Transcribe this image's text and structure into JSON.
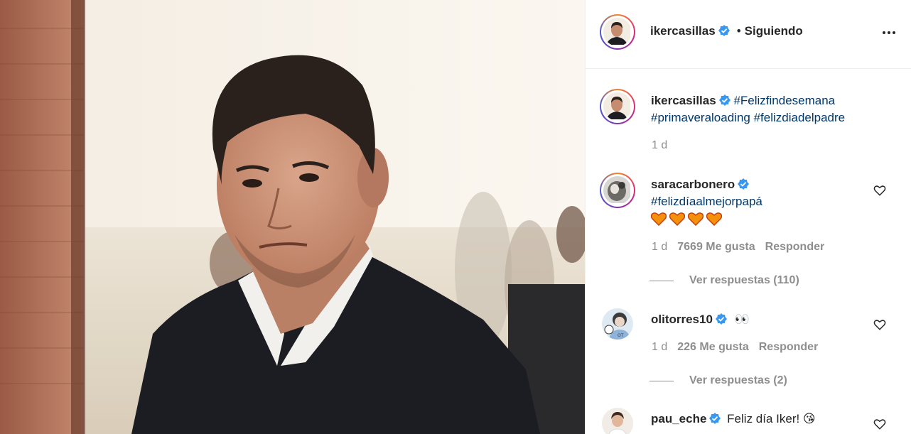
{
  "header": {
    "username": "ikercasillas",
    "separator": "•",
    "follow_status": "Siguiendo",
    "more_icon": "more-horizontal-icon"
  },
  "caption": {
    "username": "ikercasillas",
    "hashtags_line1": "#Felizfindesemana",
    "hashtags_line2": "#primaveraloading #felizdiadelpadre",
    "time": "1 d"
  },
  "comments": [
    {
      "username": "saracarbonero",
      "text": "#felizdíaalmejorpapá",
      "emoji": "orange-heart x4",
      "time": "1 d",
      "likes": "7669 Me gusta",
      "reply_label": "Responder",
      "view_replies": "Ver respuestas (110)"
    },
    {
      "username": "olitorres10",
      "text": "👀",
      "time": "1 d",
      "likes": "226 Me gusta",
      "reply_label": "Responder",
      "view_replies": "Ver respuestas (2)"
    },
    {
      "username": "pau_eche",
      "text": "Feliz día Iker! 😘"
    }
  ],
  "colors": {
    "hashtag": "#00376b",
    "verified": "#3897f0",
    "muted": "#8e8e8e",
    "text": "#262626",
    "heart_emoji": "#f4900c"
  }
}
